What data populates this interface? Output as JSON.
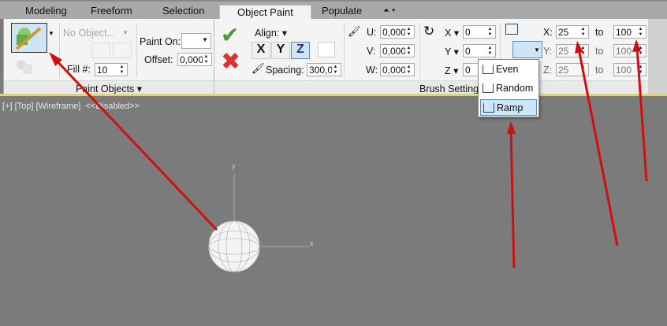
{
  "tabs": [
    {
      "label": "Modeling"
    },
    {
      "label": "Freeform"
    },
    {
      "label": "Selection"
    },
    {
      "label": "Object Paint",
      "active": true
    },
    {
      "label": "Populate"
    }
  ],
  "paint_objects": {
    "object_dropdown": "No Object...",
    "fill_label": "Fill #:",
    "fill_value": "10",
    "paint_on_label": "Paint On:",
    "offset_label": "Offset:",
    "offset_value": "0,000",
    "group_label": "Paint Objects"
  },
  "align": {
    "label": "Align:",
    "x": "X",
    "y": "Y",
    "z": "Z",
    "active": "Z",
    "spacing_label": "Spacing:",
    "spacing_value": "300,0"
  },
  "brush": {
    "u_label": "U:",
    "u": "0,000",
    "v_label": "V:",
    "v": "0,000",
    "w_label": "W:",
    "w": "0,000",
    "rx_label": "X",
    "rx": "0",
    "ry_label": "Y",
    "ry": "0",
    "rz_label": "Z",
    "rz": "0",
    "group_label": "Brush Settings"
  },
  "scale": {
    "x_label": "X:",
    "x_from": "25",
    "y_label": "Y:",
    "y_from": "25",
    "z_label": "Z:",
    "z_from": "25",
    "to": "to",
    "x_to": "100",
    "y_to": "100",
    "z_to": "100"
  },
  "scale_menu": {
    "items": [
      "Even",
      "Random",
      "Ramp"
    ],
    "selected": "Ramp"
  },
  "viewport": {
    "label": "[+] [Top] [Wireframe]",
    "disabled": "<<Disabled>>",
    "axis_x": "x",
    "axis_y": "y"
  },
  "colors": {
    "annotation_arrow": "#d01010",
    "viewport_bg": "#7b7b7b",
    "highlight": "#cfe4f5"
  }
}
